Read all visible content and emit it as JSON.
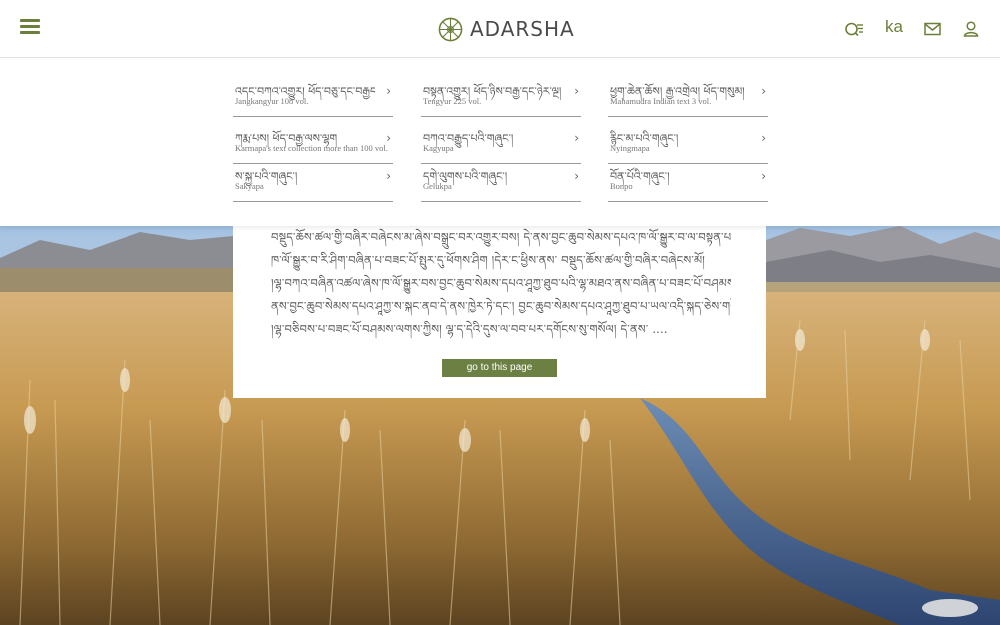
{
  "header": {
    "logo_text": "ADARSHA",
    "lang_label": "ka",
    "icons": [
      "menu-icon",
      "search-list-icon",
      "mail-icon",
      "user-icon"
    ],
    "accent_color": "#6b7f3a"
  },
  "menu": {
    "items": [
      {
        "tibetan": "འདང་བཀའ་འགྱུར། ཕོད་བཅུ་དང་བརྒྱད།",
        "english": "Jangkangyur 108 vol."
      },
      {
        "tibetan": "བསྟན་འགྱུར། ཕོད་ཉིས་བརྒྱ་དང་ཉེར་ལྔ།",
        "english": "Tengyur 225 vol."
      },
      {
        "tibetan": "ཕྱག་ཆེན་ཆོས། རྒྱ་འགྲེལ། ཕོད་གསུམ།",
        "english": "Mahamudra Indian text 3 vol."
      },
      {
        "tibetan": "ཀརྨ་པས། ཕོད་བརྒྱ་ལས་ལྷག",
        "english": "Karmapa's text collection more than 100 vol."
      },
      {
        "tibetan": "བཀའ་བརྒྱུད་པའི་གཞུང་།",
        "english": "Kagyupa"
      },
      {
        "tibetan": "རྙིང་མ་པའི་གཞུང་།",
        "english": "Nyingmapa"
      },
      {
        "tibetan": "ས་སྐྱ་པའི་གཞུང་།",
        "english": "Sakyapa"
      },
      {
        "tibetan": "དགེ་ལུགས་པའི་གཞུང་།",
        "english": "Gelukpa"
      },
      {
        "tibetan": "བོན་པོའི་གཞུང་།",
        "english": "Bonpo"
      }
    ]
  },
  "card": {
    "lines": [
      "བསྡུད་ཆོས་ཚལ་གྱི་བཞིར་བཞེངས་མ་ཞེས་བསྒྲུང་བར་འགྱུར་བས། དེ་ནས་བྱང་ཆུབ་སེམས་དཔའ་ཁ་ལོ་སྒྱུར་བ་ལ་བསྟན་པ།",
      "ཁ་ལོ་སྒྱུར་བ་རི་ཤིག་བཞིན་པ་བཟང་པོ་སྤུར་དུ་ཕོགས་ཤིག །དེར་ང་ཕྱིས་ནས་ བསྡུད་ཆོས་ཚལ་གྱི་བཞིར་བཞེངས་མོ།",
      "།ལྷ་བཀའ་བཞིན་འཚལ་ཞེས་ཁ་ལོ་སྒྱུར་བས་བྱང་ཆུབ་སེམས་དཔའ་ཤཱཀྱ་ཐུབ་པའི་ལྷ་མཐའ་ནས་བཞིན་པ་བཟང་པོ་བཤམས་",
      "ནས་བྱང་ཆུབ་སེམས་དཔའ་ཤཱཀྱ་ས་སྐང་ནབ་དེ་ནས་ཁྱེར་ཏེ་དང་། བྱང་ཆུབ་སེམས་དཔའ་ཤཱཀྱ་ཐུབ་པ་ཡལ་འདི་སྐད་ཅེས་གསོལ་ཏོ།",
      "།ལྷ་བཅིབས་པ་བཟང་པོ་བཤམས་ལགས་ཀྱིས། ལྷ་ད་དེའི་དུས་ལ་བབ་པར་དགོངས་སུ་གསོལ། དེ་ནས་  ...."
    ],
    "button_label": "go to this page"
  }
}
